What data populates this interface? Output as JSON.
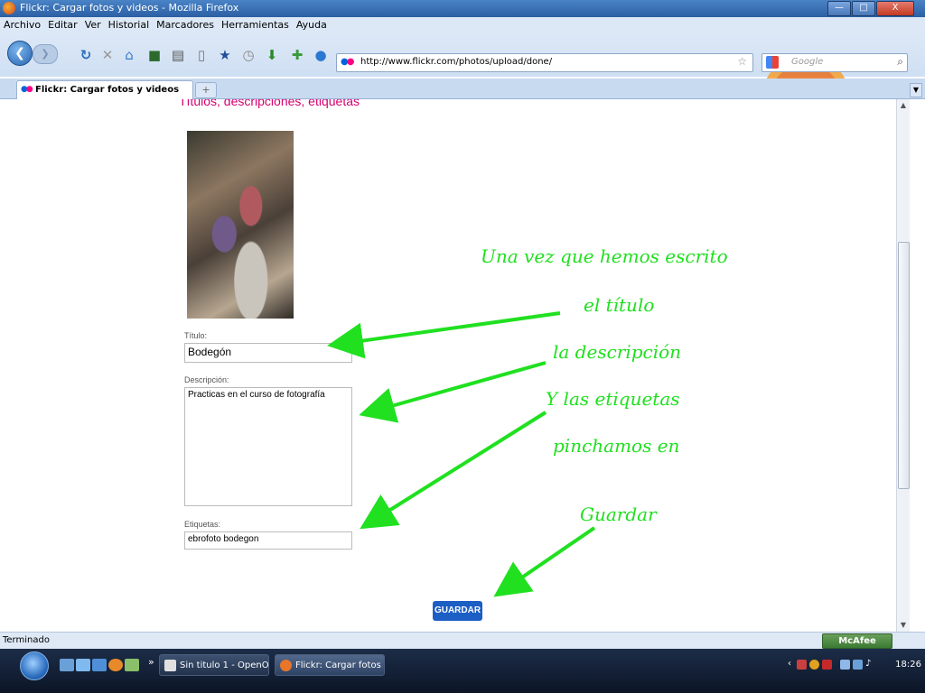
{
  "window": {
    "title": "Flickr: Cargar fotos y videos - Mozilla Firefox",
    "controls": [
      "—",
      "□",
      "X"
    ]
  },
  "menu": [
    "Archivo",
    "Editar",
    "Ver",
    "Historial",
    "Marcadores",
    "Herramientas",
    "Ayuda"
  ],
  "nav": {
    "url": "http://www.flickr.com/photos/upload/done/",
    "search_placeholder": "Google"
  },
  "tab": {
    "label": "Flickr: Cargar fotos y videos",
    "new_tab": "+"
  },
  "page": {
    "heading": "Títulos, descripciones, etiquetas",
    "titulo_label": "Título:",
    "titulo_value": "Bodegón",
    "descripcion_label": "Descripción:",
    "descripcion_value": "Practicas en el curso de fotografía",
    "etiquetas_label": "Etiquetas:",
    "etiquetas_value": "ebrofoto bodegon",
    "save_button": "GUARDAR"
  },
  "annotations": [
    "Una vez que hemos escrito",
    "el título",
    "la descripción",
    "Y las etiquetas",
    "pinchamos en",
    "Guardar"
  ],
  "status": {
    "text": "Terminado",
    "mcafee": "McAfee"
  },
  "taskbar": {
    "tasks": [
      "Sin titulo 1 - OpenO...",
      "Flickr: Cargar fotos ..."
    ],
    "clock": "18:26",
    "chevron": "»"
  },
  "colors": {
    "accent": "#d40070",
    "annotation": "#20e020",
    "button": "#1b5ec4"
  }
}
